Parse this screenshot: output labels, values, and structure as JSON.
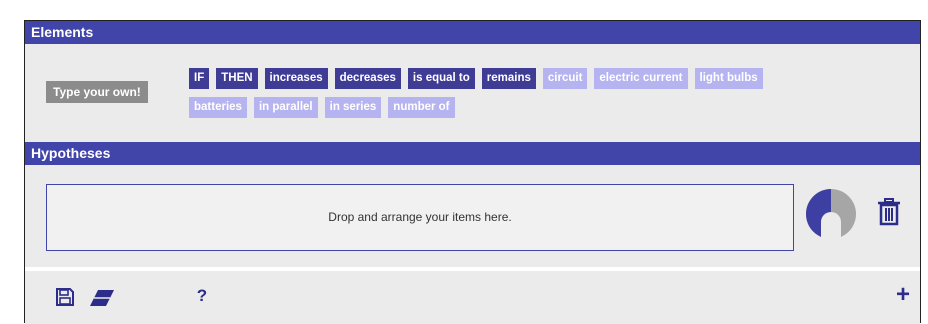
{
  "elements": {
    "title": "Elements",
    "type_own_label": "Type your own!",
    "chips": [
      {
        "label": "IF",
        "style": "dark"
      },
      {
        "label": "THEN",
        "style": "dark"
      },
      {
        "label": "increases",
        "style": "dark"
      },
      {
        "label": "decreases",
        "style": "dark"
      },
      {
        "label": "is equal to",
        "style": "dark"
      },
      {
        "label": "remains",
        "style": "dark"
      },
      {
        "label": "circuit",
        "style": "light"
      },
      {
        "label": "electric current",
        "style": "light"
      },
      {
        "label": "light bulbs",
        "style": "light"
      },
      {
        "label": "batteries",
        "style": "light"
      },
      {
        "label": "in parallel",
        "style": "light"
      },
      {
        "label": "in series",
        "style": "light"
      },
      {
        "label": "number of",
        "style": "light"
      }
    ]
  },
  "hypotheses": {
    "title": "Hypotheses",
    "drop_placeholder": "Drop and arrange your items here.",
    "progress_fraction": 0.5
  },
  "toolbar": {
    "save_icon": "save-icon",
    "eraser_icon": "eraser-icon",
    "help_label": "?",
    "add_label": "+"
  },
  "colors": {
    "header": "#4144a8",
    "chip_dark": "#3f3c96",
    "chip_light": "#b5b4f1",
    "type_own": "#8c8c8c",
    "panel": "#ebebeb",
    "icon": "#2c2c8a"
  }
}
